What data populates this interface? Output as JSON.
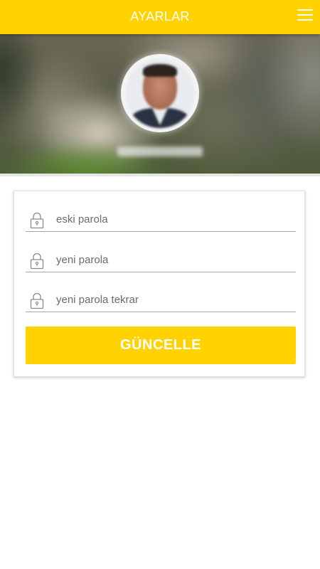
{
  "header": {
    "title": "AYARLAR",
    "menu_icon": "hamburger-menu-icon",
    "background_color": "#ffd200",
    "title_color": "#ffffff"
  },
  "profile": {
    "avatar_icon": "user-avatar"
  },
  "form": {
    "fields": [
      {
        "placeholder": "eski parola",
        "value": "",
        "icon": "lock-icon"
      },
      {
        "placeholder": "yeni parola",
        "value": "",
        "icon": "lock-icon"
      },
      {
        "placeholder": "yeni parola tekrar",
        "value": "",
        "icon": "lock-icon"
      }
    ],
    "submit_label": "GÜNCELLE",
    "submit_color": "#ffd200"
  }
}
